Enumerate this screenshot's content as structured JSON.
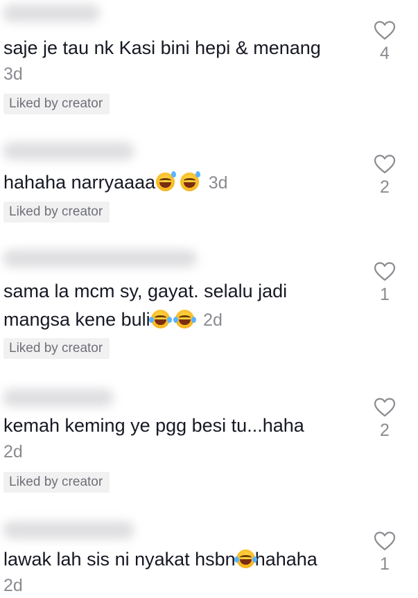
{
  "comments": [
    {
      "text": "saje je tau nk Kasi bini hepi & menang",
      "time": "3d",
      "badge": "Liked by creator",
      "like_count": "4"
    },
    {
      "text": "hahaha narryaaaa",
      "emojis": [
        "grinning-sweat-emoji",
        "grinning-sweat-emoji"
      ],
      "time": "3d",
      "badge": "Liked by creator",
      "like_count": "2"
    },
    {
      "text_line1": "sama la mcm sy, gayat. selalu jadi",
      "text_line2": "mangsa kene buli",
      "emojis": [
        "tears-of-joy-emoji",
        "tears-of-joy-emoji"
      ],
      "time": "2d",
      "badge": "Liked by creator",
      "like_count": "1"
    },
    {
      "text": "kemah keming ye pgg besi tu...haha",
      "time": "2d",
      "badge": "Liked by creator",
      "like_count": "2"
    },
    {
      "text_before": "lawak lah sis ni nyakat hsbn",
      "text_after": "hahaha",
      "emojis": [
        "tears-of-joy-emoji"
      ],
      "time": "2d",
      "like_count": "1"
    }
  ],
  "icons": {
    "like": "heart-outline-icon"
  },
  "colors": {
    "text": "#161823",
    "muted": "#8a8b91",
    "badge_bg": "#f1f1f2"
  }
}
